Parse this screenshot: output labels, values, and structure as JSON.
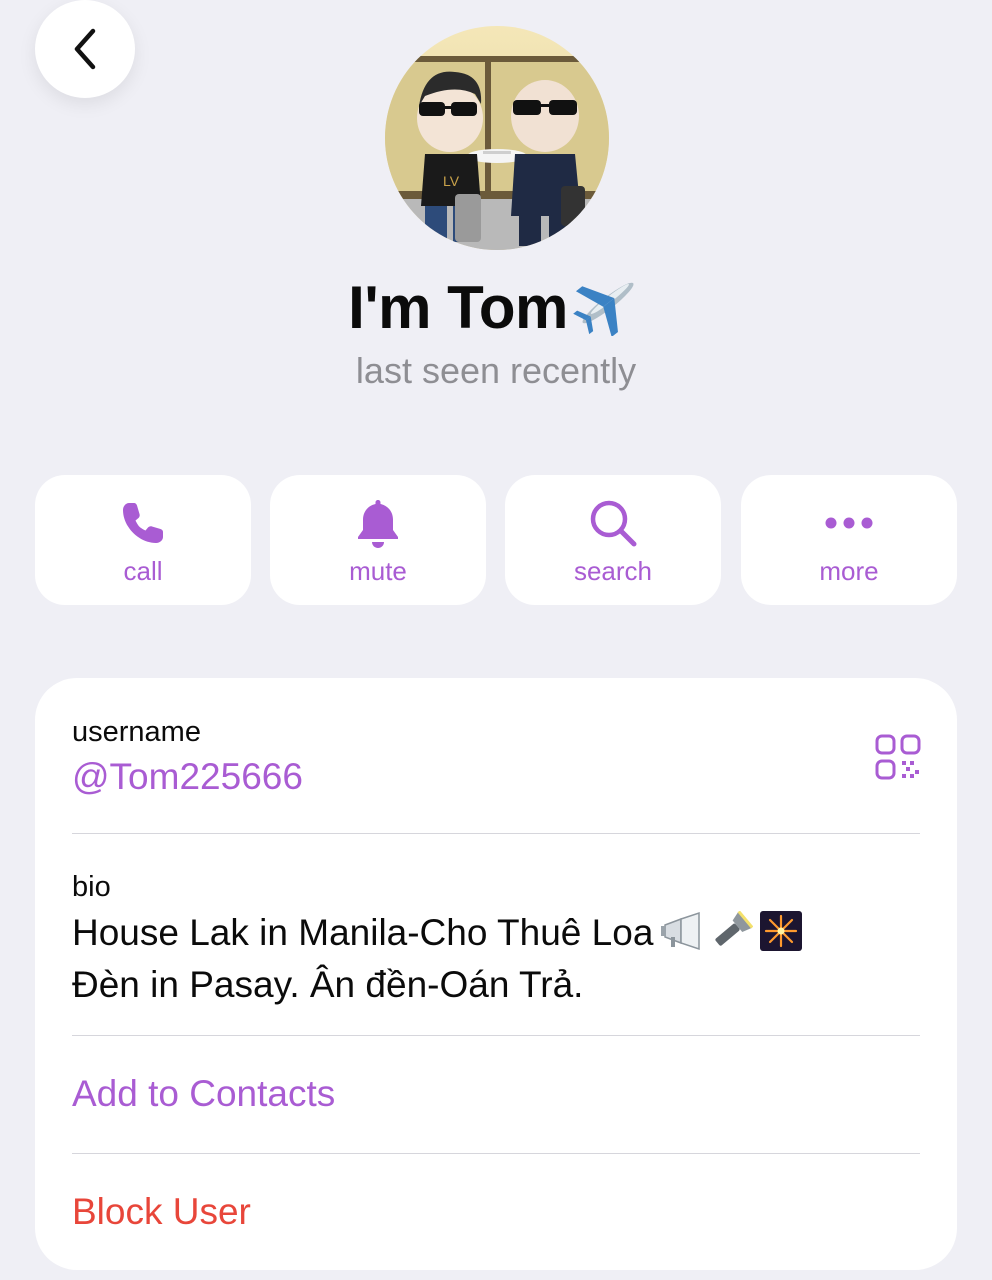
{
  "header": {
    "back_icon": "chevron-left-icon"
  },
  "profile": {
    "name": "I'm Tom",
    "name_emoji": "airplane-icon",
    "status": "last seen recently"
  },
  "actions": [
    {
      "label": "call",
      "icon": "phone-icon"
    },
    {
      "label": "mute",
      "icon": "bell-icon"
    },
    {
      "label": "search",
      "icon": "search-icon"
    },
    {
      "label": "more",
      "icon": "more-dots-icon"
    }
  ],
  "info": {
    "username_label": "username",
    "username_value": "@Tom225666",
    "bio_label": "bio",
    "bio_line1": "House Lak in Manila-Cho Thuê Loa",
    "bio_line2": "Đèn in Pasay. Ân đền-Oán Trả.",
    "add_contacts": "Add to Contacts",
    "block_user": "Block User"
  },
  "colors": {
    "accent": "#a95cd3",
    "danger": "#e8463a",
    "background": "#efeff5",
    "secondary_text": "#8e8e93"
  }
}
